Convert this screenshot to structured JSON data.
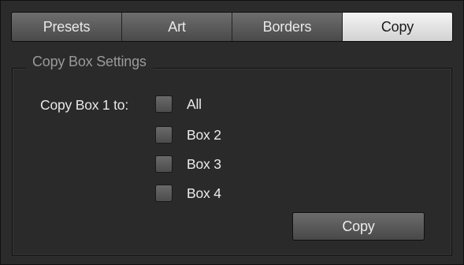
{
  "tabs": [
    {
      "label": "Presets",
      "active": false
    },
    {
      "label": "Art",
      "active": false
    },
    {
      "label": "Borders",
      "active": false
    },
    {
      "label": "Copy",
      "active": true
    }
  ],
  "group": {
    "legend": "Copy Box Settings",
    "row_label": "Copy Box 1 to:",
    "options": [
      {
        "label": "All",
        "checked": false
      },
      {
        "label": "Box 2",
        "checked": false
      },
      {
        "label": "Box 3",
        "checked": false
      },
      {
        "label": "Box 4",
        "checked": false
      }
    ],
    "copy_button_label": "Copy"
  },
  "colors": {
    "background": "#2b2b2b",
    "active_tab": "#e6e6e6",
    "inactive_tab": "#5a5a5a",
    "text": "#e8e8e8",
    "legend_text": "#9a9a9a"
  }
}
